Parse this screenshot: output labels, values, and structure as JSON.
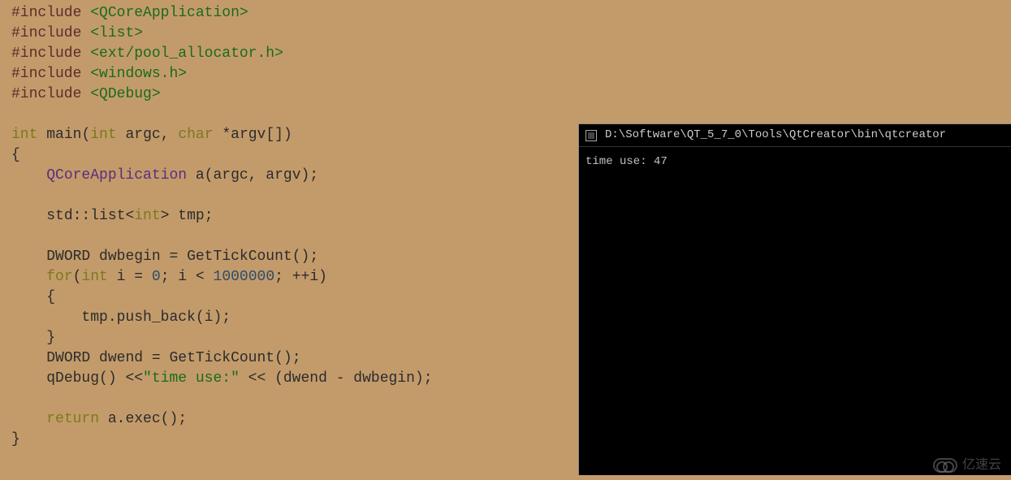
{
  "code": {
    "inc_directive": "#include",
    "inc1": "<QCoreApplication>",
    "inc2": "<list>",
    "inc3": "<ext/pool_allocator.h>",
    "inc4": "<windows.h>",
    "inc5": "<QDebug>",
    "kw_int": "int",
    "fn_main": "main",
    "kw_char": "char",
    "arg_argc": "argc",
    "arg_argv": "argv",
    "open_paren": "(",
    "close_paren": ")",
    "open_brace": "{",
    "close_brace": "}",
    "star": "*",
    "brackets": "[]",
    "comma": ",",
    "semicolon": ";",
    "type_qcoreapp": "QCoreApplication",
    "var_a": "a",
    "paren_args_a": "(argc, argv)",
    "std_list": "std::list",
    "angle_open": "<",
    "angle_close": ">",
    "var_tmp": "tmp",
    "type_dword1": "DWORD",
    "var_dwbegin": "dwbegin",
    "eq": " = ",
    "fn_gettick": "GetTickCount",
    "empty_call": "()",
    "kw_for": "for",
    "var_i": "i",
    "zero": "0",
    "lt": " < ",
    "million": "1000000",
    "semi_sp": "; ",
    "preinc": "++",
    "tmp_push": "tmp.push_back",
    "paren_i": "(i)",
    "type_dword2": "DWORD",
    "var_dwend": "dwend",
    "fn_qdebug": "qDebug",
    "lshift": " <<",
    "str_timeuse": "\"time use:\"",
    "expr_diff": " (dwend - dwbegin)",
    "kw_return": "return",
    "a_exec": "a.exec"
  },
  "console": {
    "title": "D:\\Software\\QT_5_7_0\\Tools\\QtCreator\\bin\\qtcreator",
    "output": "time use: 47"
  },
  "watermark": {
    "text": "亿速云"
  }
}
